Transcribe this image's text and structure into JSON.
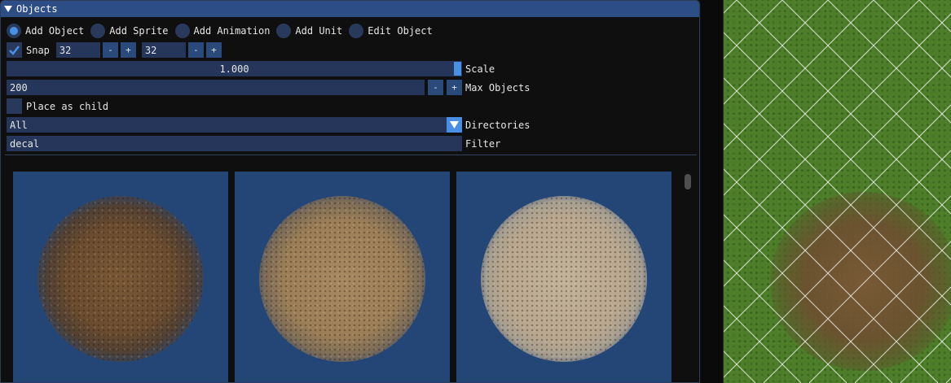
{
  "window": {
    "title": "Objects"
  },
  "modes": [
    {
      "label": "Add Object",
      "selected": true
    },
    {
      "label": "Add Sprite",
      "selected": false
    },
    {
      "label": "Add Animation",
      "selected": false
    },
    {
      "label": "Add Unit",
      "selected": false
    },
    {
      "label": "Edit Object",
      "selected": false
    }
  ],
  "snap": {
    "label": "Snap",
    "checked": true,
    "x": "32",
    "y": "32",
    "minus": "-",
    "plus": "+"
  },
  "scale": {
    "value": "1.000",
    "label": "Scale"
  },
  "max_objects": {
    "value": "200",
    "label": "Max Objects",
    "minus": "-",
    "plus": "+"
  },
  "place_as_child": {
    "label": "Place as child",
    "checked": false
  },
  "directories": {
    "value": "All",
    "label": "Directories"
  },
  "filter": {
    "value": "decal",
    "label": "Filter"
  },
  "thumbnails": [
    {
      "icon": "dark-dirt-decal"
    },
    {
      "icon": "gravel-decal"
    },
    {
      "icon": "sand-decal"
    }
  ],
  "colors": {
    "title_bar": "#2d4d86",
    "accent": "#4a8fe6",
    "frame": "#25365a",
    "thumbnail_bg": "#234677",
    "grass": "#4e7d2a"
  }
}
